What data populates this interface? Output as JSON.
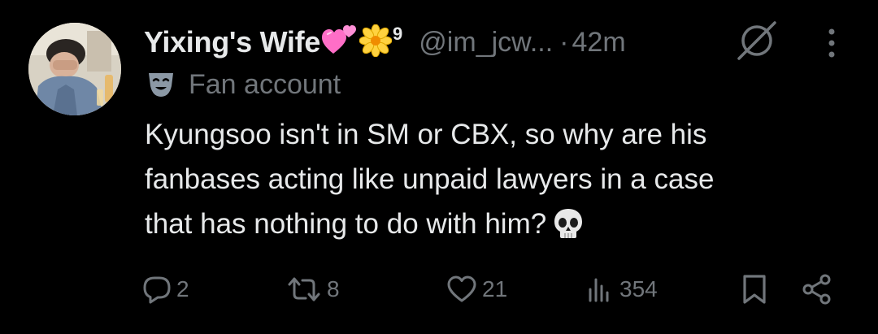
{
  "post": {
    "display_name": "Yixing's Wife",
    "name_suffix": "9",
    "handle": "@im_jcw...",
    "separator": "·",
    "time": "42m",
    "label": "Fan account",
    "text_lines": [
      "Kyungsoo isn't in SM or CBX, so why are his",
      "fanbases acting like unpaid lawyers in a case",
      "that has nothing to do with him?"
    ]
  },
  "actions": {
    "replies": "2",
    "reposts": "8",
    "likes": "21",
    "views": "354"
  },
  "icons": {
    "name_emojis": [
      "pink-hearts-icon",
      "blossom-icon"
    ],
    "label_icon": "performing-arts-mask-icon",
    "text_emoji": "skull-icon",
    "header": [
      "edited-icon",
      "more-icon"
    ],
    "action_bar": [
      "reply-icon",
      "repost-icon",
      "like-icon",
      "views-icon",
      "bookmark-icon",
      "share-icon"
    ]
  },
  "colors": {
    "background": "#000000",
    "primary_text": "#e7e9ea",
    "secondary_text": "#71767b",
    "heart_pink": "#ff6ec7",
    "blossom_yellow": "#ffd23f"
  }
}
